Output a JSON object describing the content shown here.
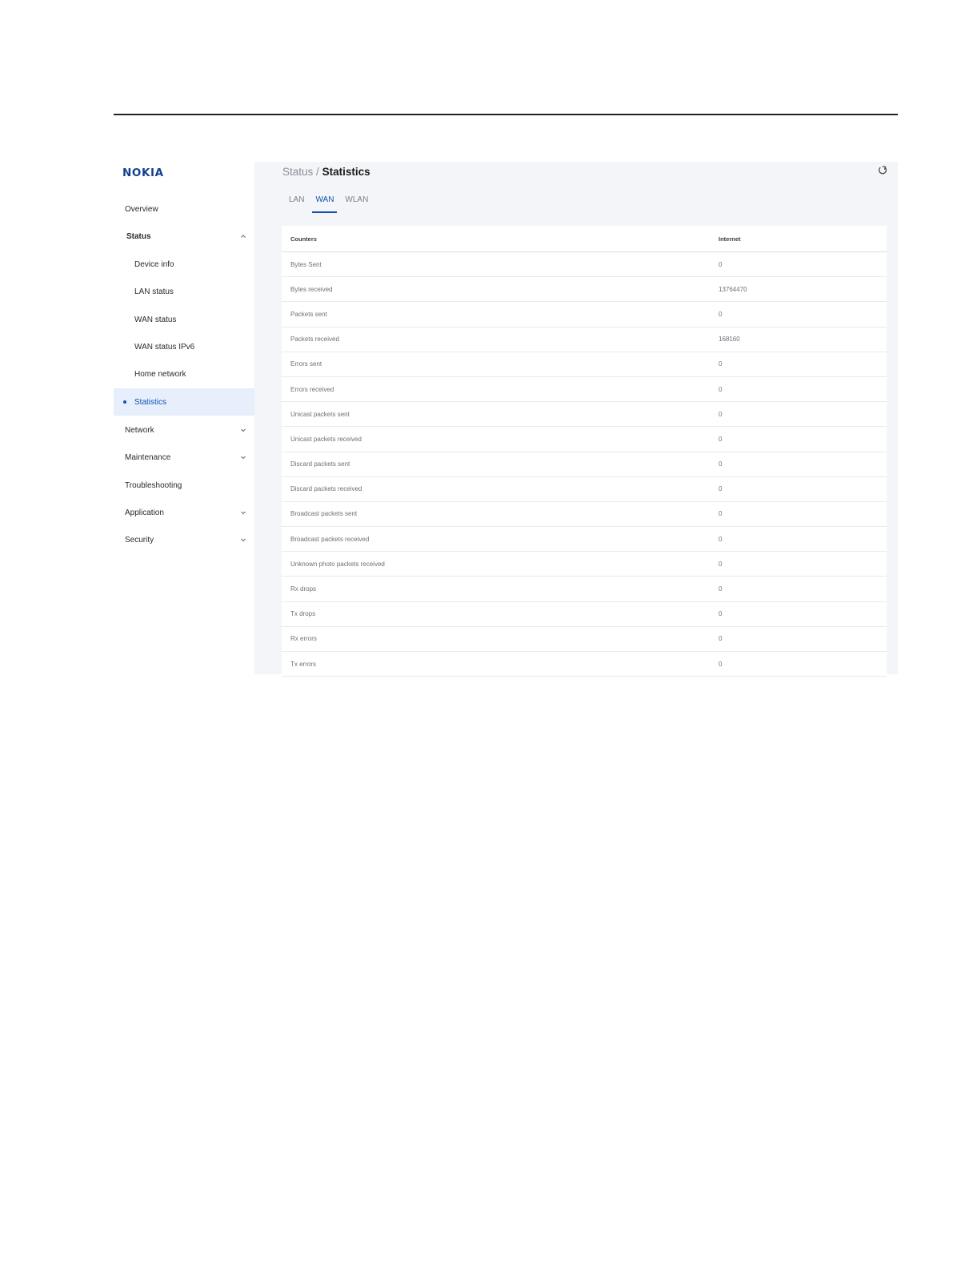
{
  "brand": {
    "logo_text": "NOKIA",
    "accent_color": "#1450b4",
    "logo_color": "#124191"
  },
  "sidebar": {
    "items": [
      {
        "label": "Overview",
        "type": "top"
      },
      {
        "label": "Status",
        "type": "group-open",
        "icon": "chevron-up-icon"
      },
      {
        "label": "Device info",
        "type": "sub"
      },
      {
        "label": "LAN status",
        "type": "sub"
      },
      {
        "label": "WAN status",
        "type": "sub"
      },
      {
        "label": "WAN status IPv6",
        "type": "sub"
      },
      {
        "label": "Home network",
        "type": "sub"
      },
      {
        "label": "Statistics",
        "type": "sub-active"
      },
      {
        "label": "Network",
        "type": "group",
        "icon": "chevron-down-icon"
      },
      {
        "label": "Maintenance",
        "type": "group",
        "icon": "chevron-down-icon"
      },
      {
        "label": "Troubleshooting",
        "type": "top"
      },
      {
        "label": "Application",
        "type": "group",
        "icon": "chevron-down-icon"
      },
      {
        "label": "Security",
        "type": "group",
        "icon": "chevron-down-icon"
      }
    ]
  },
  "header": {
    "breadcrumb_parent": "Status",
    "breadcrumb_separator": "/",
    "breadcrumb_current": "Statistics",
    "refresh_icon": "refresh-icon"
  },
  "tabs": [
    {
      "label": "LAN",
      "active": false
    },
    {
      "label": "WAN",
      "active": true
    },
    {
      "label": "WLAN",
      "active": false
    }
  ],
  "table": {
    "columns": [
      "Counters",
      "Internet"
    ],
    "rows": [
      [
        "Bytes Sent",
        "0"
      ],
      [
        "Bytes received",
        "13764470"
      ],
      [
        "Packets sent",
        "0"
      ],
      [
        "Packets received",
        "168160"
      ],
      [
        "Errors sent",
        "0"
      ],
      [
        "Errors received",
        "0"
      ],
      [
        "Unicast packets sent",
        "0"
      ],
      [
        "Unicast packets received",
        "0"
      ],
      [
        "Discard packets sent",
        "0"
      ],
      [
        "Discard packets received",
        "0"
      ],
      [
        "Broadcast packets sent",
        "0"
      ],
      [
        "Broadcast packets received",
        "0"
      ],
      [
        "Unknown photo packets received",
        "0"
      ],
      [
        "Rx drops",
        "0"
      ],
      [
        "Tx drops",
        "0"
      ],
      [
        "Rx errors",
        "0"
      ],
      [
        "Tx errors",
        "0"
      ]
    ]
  }
}
